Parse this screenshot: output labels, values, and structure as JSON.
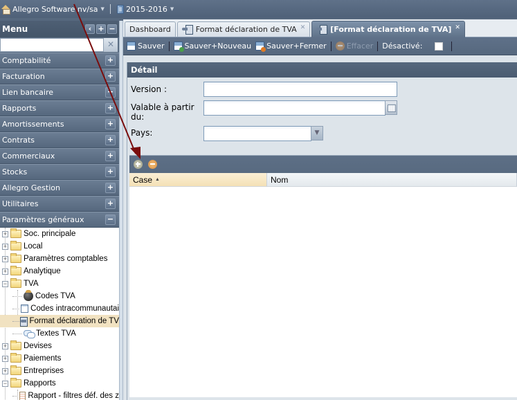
{
  "topbar": {
    "company": "Allegro Software nv/sa",
    "fiscal_year": "2015-2016"
  },
  "menu": {
    "title": "Menu",
    "search_placeholder": "",
    "sections": [
      {
        "label": "Comptabilité",
        "state": "+"
      },
      {
        "label": "Facturation",
        "state": "+"
      },
      {
        "label": "Lien bancaire",
        "state": "-"
      },
      {
        "label": "Rapports",
        "state": "+"
      },
      {
        "label": "Amortissements",
        "state": "+"
      },
      {
        "label": "Contrats",
        "state": "+"
      },
      {
        "label": "Commerciaux",
        "state": "+"
      },
      {
        "label": "Stocks",
        "state": "+"
      },
      {
        "label": "Allegro Gestion",
        "state": "+"
      },
      {
        "label": "Utilitaires",
        "state": "+"
      },
      {
        "label": "Paramètres généraux",
        "state": "-"
      }
    ],
    "tree": [
      {
        "label": "Soc. principale",
        "type": "folder",
        "expanded": false
      },
      {
        "label": "Local",
        "type": "folder",
        "expanded": false
      },
      {
        "label": "Paramètres comptables",
        "type": "folder",
        "expanded": false
      },
      {
        "label": "Analytique",
        "type": "folder",
        "expanded": false
      },
      {
        "label": "TVA",
        "type": "folder",
        "expanded": true
      },
      {
        "label": "Codes TVA",
        "type": "leaf",
        "icon": "bomb-icon"
      },
      {
        "label": "Codes intracommunautai",
        "type": "leaf",
        "icon": "window-icon"
      },
      {
        "label": "Format déclaration de TV",
        "type": "leaf",
        "icon": "format-icon",
        "selected": true
      },
      {
        "label": "Textes TVA",
        "type": "leaf",
        "icon": "speech-bubbles-icon"
      },
      {
        "label": "Devises",
        "type": "folder",
        "expanded": false
      },
      {
        "label": "Paiements",
        "type": "folder",
        "expanded": false
      },
      {
        "label": "Entreprises",
        "type": "folder",
        "expanded": false
      },
      {
        "label": "Rapports",
        "type": "folder",
        "expanded": true
      },
      {
        "label": "Rapport - filtres déf. des z",
        "type": "leaf",
        "icon": "report-icon"
      }
    ]
  },
  "tabs": [
    {
      "label": "Dashboard",
      "closable": false,
      "active": false
    },
    {
      "label": "Format déclaration de TVA",
      "closable": true,
      "active": false
    },
    {
      "label": "[Format déclaration de TVA]",
      "closable": true,
      "active": true
    }
  ],
  "toolbar": {
    "save": "Sauver",
    "save_new": "Sauver+Nouveau",
    "save_close": "Sauver+Fermer",
    "erase": "Effacer",
    "disabled_label": "Désactivé:",
    "disabled_checked": false
  },
  "detail": {
    "title": "Détail",
    "version_label": "Version :",
    "version_value": "",
    "valid_from_label_1": "Valable à partir",
    "valid_from_label_2": "du:",
    "valid_from_value": "",
    "country_label": "Pays:",
    "country_value": ""
  },
  "grid": {
    "columns": [
      {
        "label": "Case",
        "sort": "asc"
      },
      {
        "label": "Nom"
      }
    ],
    "rows": []
  },
  "colors": {
    "header_bg": "#56687e",
    "selected_row": "#f1e2c1",
    "sorted_column": "#f4e1b6",
    "annotation_arrow": "#7a0d0d"
  }
}
